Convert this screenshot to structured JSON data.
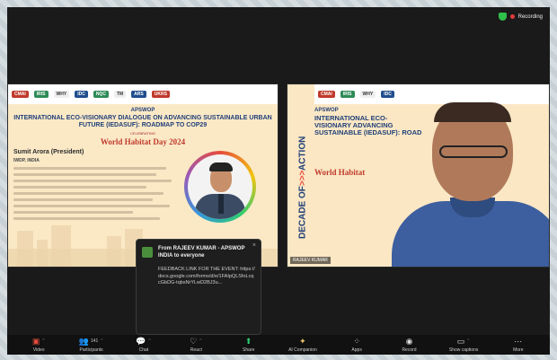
{
  "status": {
    "recording_label": "Recording"
  },
  "slide_left": {
    "logos": [
      "CMAI",
      "IRIS",
      "WHY",
      "IDC",
      "NQC",
      "TM",
      "ARS",
      "UKRS"
    ],
    "org": "APSWOP",
    "title": "INTERNATIONAL ECO-VISIONARY DIALOGUE ON ADVANCING SUSTAINABLE URBAN FUTURE (IEDASUF): ROADMAP TO COP29",
    "subtitle": "CELEBRATING",
    "event": "World Habitat Day 2024",
    "speaker_name": "Sumit Arora (President)",
    "speaker_org": "IWDP, INDIA",
    "name_tag": ""
  },
  "slide_right": {
    "side_banner_left": "DECADE OF",
    "side_banner_arrows": ">>>",
    "side_banner_right": "ACTION",
    "org": "APSWOP",
    "title": "INTERNATIONAL ECO-VISIONARY ADVANCING SUSTAINABLE (IEDASUF): ROAD",
    "event": "World Habitat",
    "name_tag": "RAJEEV KUMAR"
  },
  "chat": {
    "from": "From RAJEEV KUMAR - APSWOP INDIA to everyone",
    "message": "FEEDBACK LINK FOR THE EVENT: https://docs.google.com/forms/d/e/1FAIpQLSfoLcqcGbDG-tqbsNrYLwD2BJ3u..."
  },
  "toolbar": {
    "video": "Video",
    "participants": "Participants",
    "participants_count": "141",
    "chat": "Chat",
    "react": "React",
    "share": "Share",
    "ai_companion": "AI Companion",
    "apps": "Apps",
    "record": "Record",
    "show_captions": "Show captions",
    "more": "More"
  }
}
